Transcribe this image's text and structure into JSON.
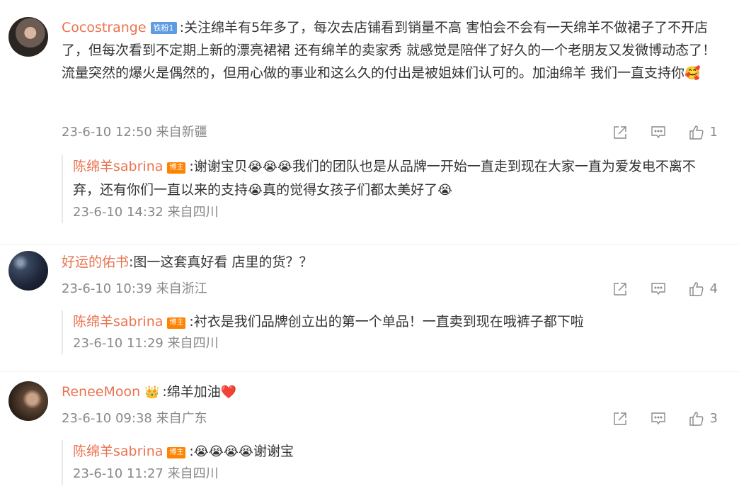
{
  "comments": [
    {
      "username": "Cocostrange",
      "badge": "铁粉1",
      "text": ":关注绵羊有5年多了，每次去店铺看到销量不高 害怕会不会有一天绵羊不做裙子了不开店了，但每次看到不定期上新的漂亮裙裙 还有绵羊的卖家秀 就感觉是陪伴了好久的一个老朋友又发微博动态了！流量突然的爆火是偶然的，但用心做的事业和这么久的付出是被姐妹们认可的。加油绵羊 我们一直支持你",
      "emoji_end": "🥰",
      "time": "23-6-10 12:50",
      "location": "来自新疆",
      "likes": "1",
      "reply": {
        "username": "陈绵羊sabrina",
        "badge": "博主",
        "text_a": ":谢谢宝贝",
        "emoji_a": "😭😭😭",
        "text_b": "我们的团队也是从品牌一开始一直走到现在大家一直为爱发电不离不弃，还有你们一直以来的支持",
        "emoji_b": "😭",
        "text_c": "真的觉得女孩子们都太美好了",
        "emoji_c": "😭",
        "time": "23-6-10 14:32",
        "location": "来自四川"
      }
    },
    {
      "username": "好运的佑书",
      "text": ":图一这套真好看  店里的货？？",
      "time": "23-6-10 10:39",
      "location": "来自浙江",
      "likes": "4",
      "reply": {
        "username": "陈绵羊sabrina",
        "badge": "博主",
        "text": ":衬衣是我们品牌创立出的第一个单品！一直卖到现在哦裤子都下啦",
        "time": "23-6-10 11:29",
        "location": "来自四川"
      }
    },
    {
      "username": "ReneeMoon",
      "crown": "👑",
      "text": ":绵羊加油",
      "emoji_end": "❤️",
      "time": "23-6-10 09:38",
      "location": "来自广东",
      "likes": "3",
      "reply": {
        "username": "陈绵羊sabrina",
        "badge": "博主",
        "text_a": ":",
        "emoji_a": "😭😭😭😭",
        "text_b": "谢谢宝",
        "time": "23-6-10 11:27",
        "location": "来自四川"
      }
    }
  ],
  "icons": {
    "share": "share-icon",
    "comment": "comment-icon",
    "like": "thumbs-up-icon"
  },
  "colors": {
    "username": "#eb7350",
    "meta": "#888888",
    "fan_badge": "#5e9be3",
    "host_badge": "#ff8200"
  }
}
